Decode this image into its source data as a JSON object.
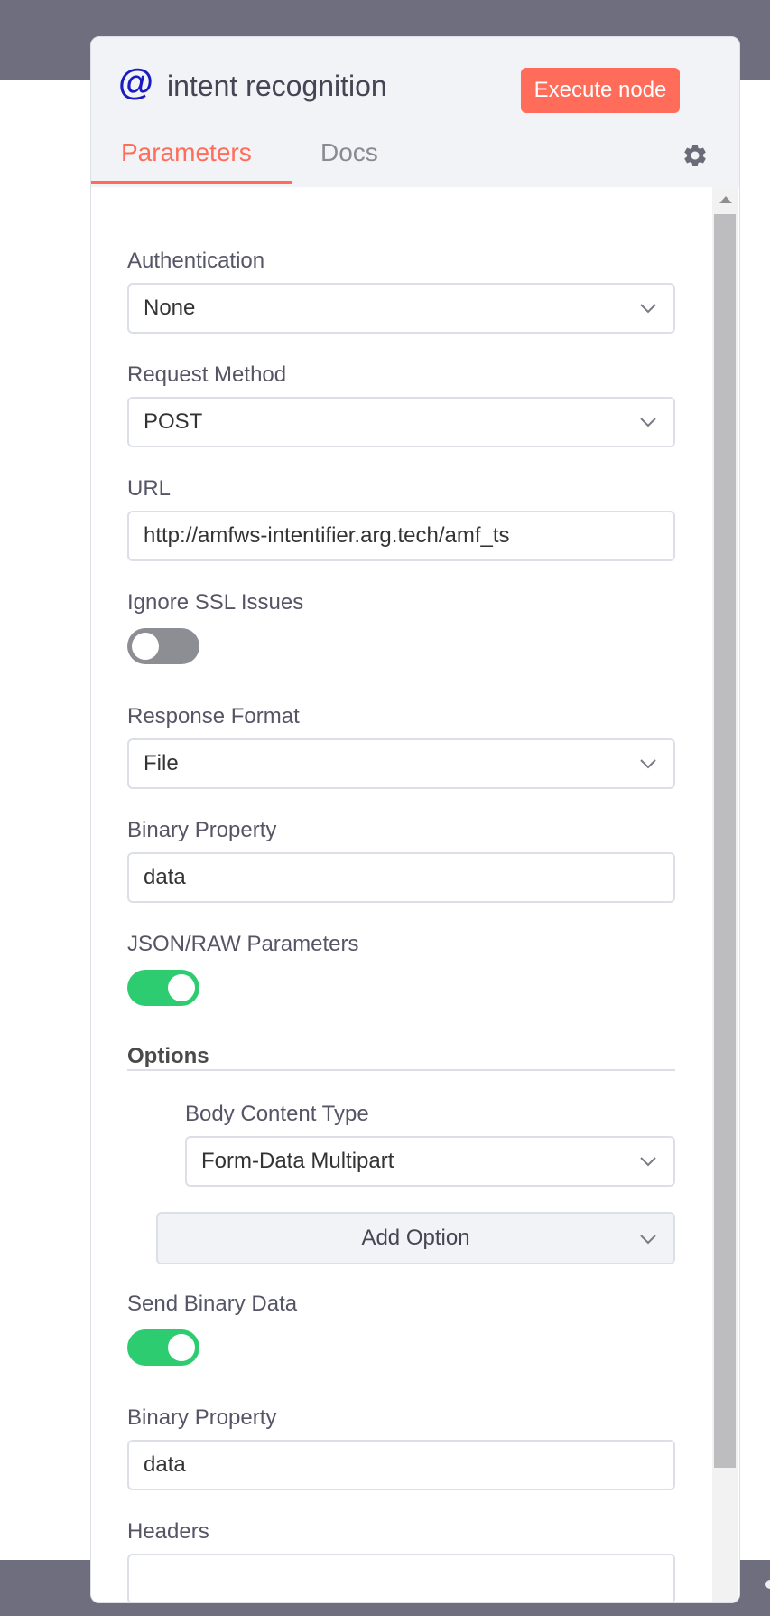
{
  "node": {
    "icon": "at-icon",
    "icon_glyph": "@",
    "title": "intent recognition",
    "execute_label": "Execute node"
  },
  "tabs": [
    {
      "label": "Parameters",
      "active": true
    },
    {
      "label": "Docs",
      "active": false
    }
  ],
  "colors": {
    "accent": "#ff6d5a",
    "toggle_on": "#2ecc71",
    "toggle_off": "#8d8e94",
    "node_icon": "#1b1bc2"
  },
  "params": {
    "authentication": {
      "label": "Authentication",
      "value": "None"
    },
    "request_method": {
      "label": "Request Method",
      "value": "POST"
    },
    "url": {
      "label": "URL",
      "value": "http://amfws-intentifier.arg.tech/amf_ts"
    },
    "ignore_ssl": {
      "label": "Ignore SSL Issues",
      "enabled": false
    },
    "response_format": {
      "label": "Response Format",
      "value": "File"
    },
    "binary_property": {
      "label": "Binary Property",
      "value": "data"
    },
    "json_raw": {
      "label": "JSON/RAW Parameters",
      "enabled": true
    },
    "options": {
      "title": "Options",
      "body_content_type": {
        "label": "Body Content Type",
        "value": "Form-Data Multipart"
      },
      "add_option_label": "Add Option"
    },
    "send_binary": {
      "label": "Send Binary Data",
      "enabled": true
    },
    "binary_property_2": {
      "label": "Binary Property",
      "value": "data"
    },
    "headers": {
      "label": "Headers",
      "value": ""
    }
  }
}
